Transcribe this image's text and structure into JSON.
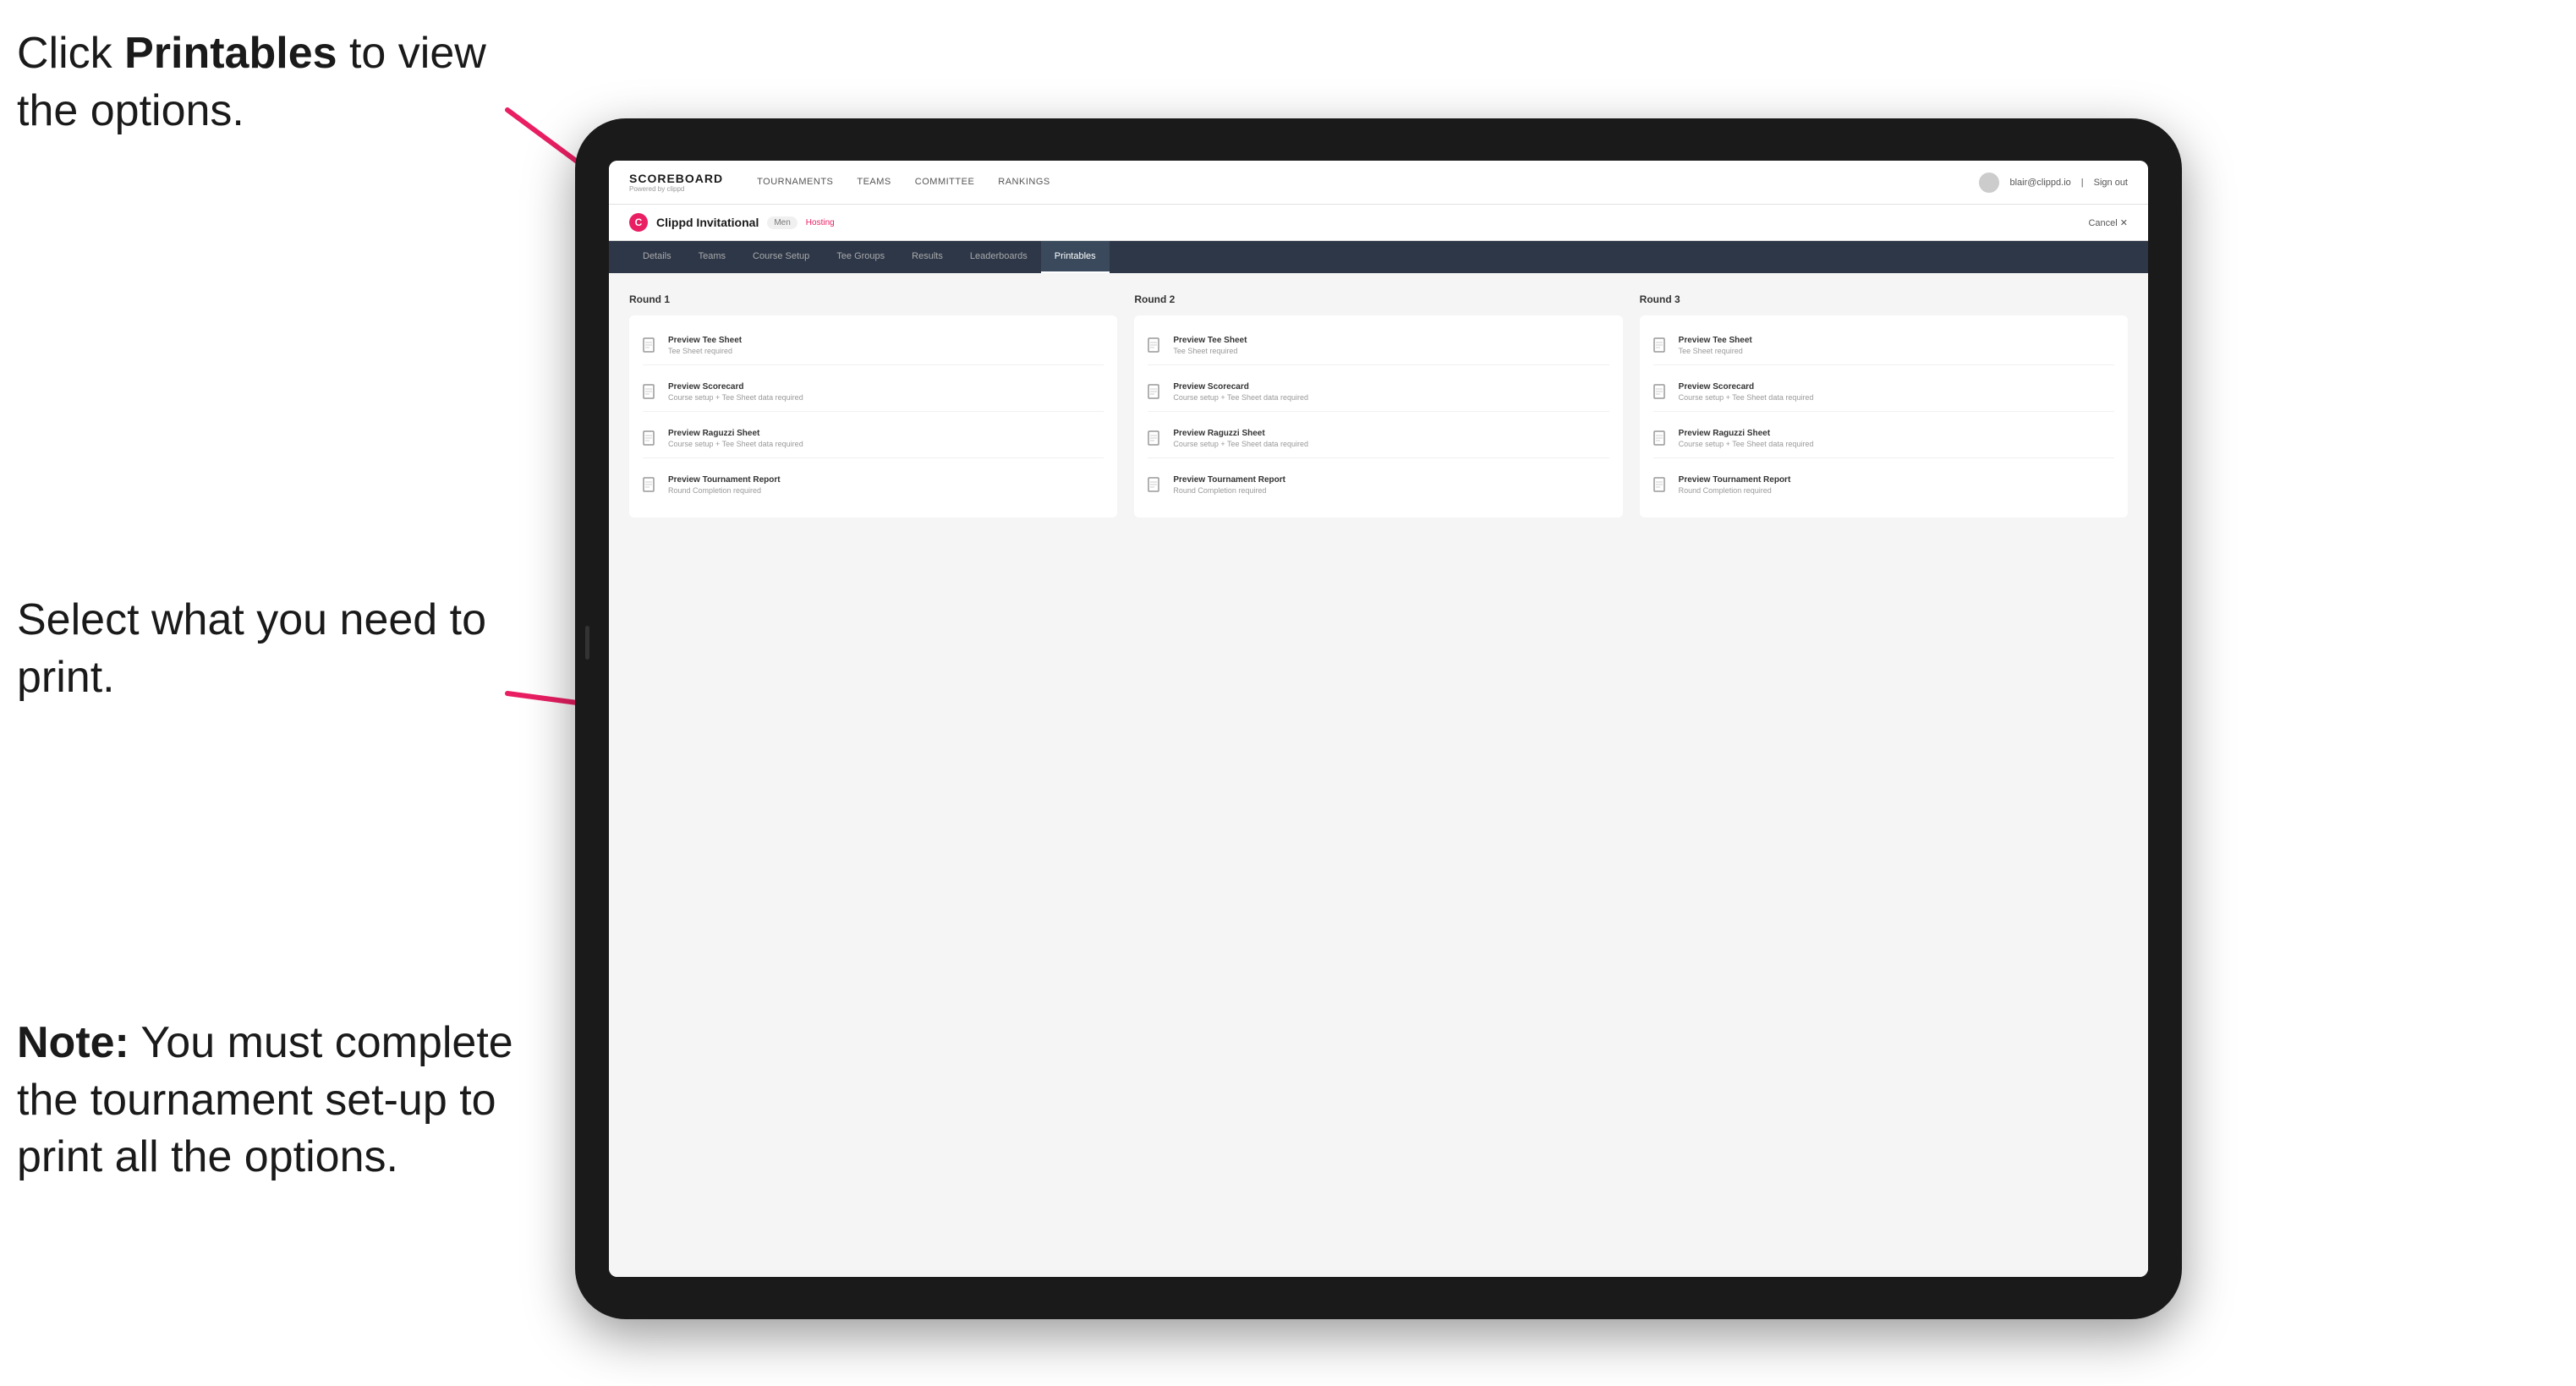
{
  "annotations": {
    "top": {
      "text_before": "Click ",
      "bold": "Printables",
      "text_after": " to view the options."
    },
    "middle": {
      "text": "Select what you need to print."
    },
    "bottom": {
      "bold": "Note:",
      "text": " You must complete the tournament set-up to print all the options."
    }
  },
  "top_nav": {
    "brand": "SCOREBOARD",
    "brand_sub": "Powered by clippd",
    "links": [
      {
        "label": "TOURNAMENTS",
        "active": false
      },
      {
        "label": "TEAMS",
        "active": false
      },
      {
        "label": "COMMITTEE",
        "active": false
      },
      {
        "label": "RANKINGS",
        "active": false
      }
    ],
    "user_email": "blair@clippd.io",
    "sign_out": "Sign out",
    "separator": "|"
  },
  "tournament_header": {
    "logo": "C",
    "name": "Clippd Invitational",
    "badge": "Men",
    "status": "Hosting",
    "cancel": "Cancel ✕"
  },
  "sub_nav": {
    "tabs": [
      {
        "label": "Details",
        "active": false
      },
      {
        "label": "Teams",
        "active": false
      },
      {
        "label": "Course Setup",
        "active": false
      },
      {
        "label": "Tee Groups",
        "active": false
      },
      {
        "label": "Results",
        "active": false
      },
      {
        "label": "Leaderboards",
        "active": false
      },
      {
        "label": "Printables",
        "active": true
      }
    ]
  },
  "rounds": [
    {
      "title": "Round 1",
      "items": [
        {
          "title": "Preview Tee Sheet",
          "sub": "Tee Sheet required"
        },
        {
          "title": "Preview Scorecard",
          "sub": "Course setup + Tee Sheet data required"
        },
        {
          "title": "Preview Raguzzi Sheet",
          "sub": "Course setup + Tee Sheet data required"
        },
        {
          "title": "Preview Tournament Report",
          "sub": "Round Completion required"
        }
      ]
    },
    {
      "title": "Round 2",
      "items": [
        {
          "title": "Preview Tee Sheet",
          "sub": "Tee Sheet required"
        },
        {
          "title": "Preview Scorecard",
          "sub": "Course setup + Tee Sheet data required"
        },
        {
          "title": "Preview Raguzzi Sheet",
          "sub": "Course setup + Tee Sheet data required"
        },
        {
          "title": "Preview Tournament Report",
          "sub": "Round Completion required"
        }
      ]
    },
    {
      "title": "Round 3",
      "items": [
        {
          "title": "Preview Tee Sheet",
          "sub": "Tee Sheet required"
        },
        {
          "title": "Preview Scorecard",
          "sub": "Course setup + Tee Sheet data required"
        },
        {
          "title": "Preview Raguzzi Sheet",
          "sub": "Course setup + Tee Sheet data required"
        },
        {
          "title": "Preview Tournament Report",
          "sub": "Round Completion required"
        }
      ]
    }
  ],
  "colors": {
    "accent": "#e91e63",
    "nav_bg": "#2d3748",
    "active_tab_bg": "#3a4a5c"
  }
}
